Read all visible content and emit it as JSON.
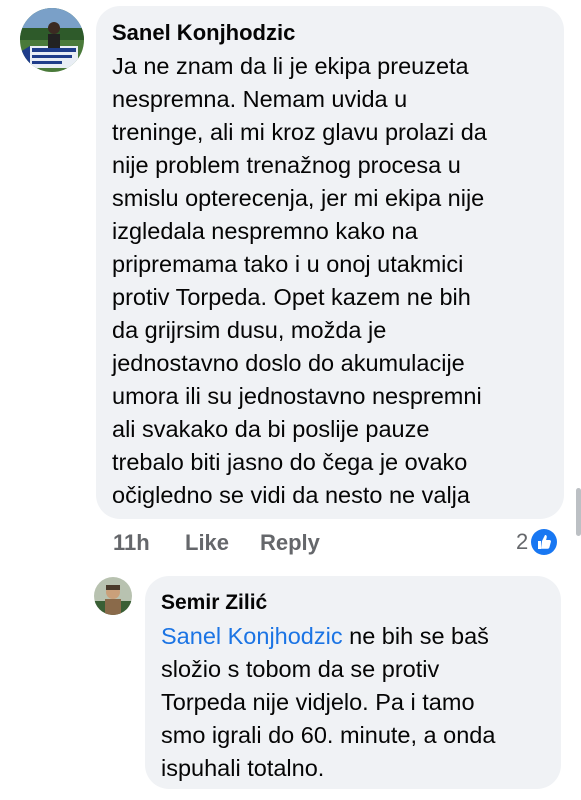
{
  "comment": {
    "author": "Sanel Konjhodzic",
    "lines": [
      "Ja ne znam da li je ekipa preuzeta",
      "nespremna. Nemam uvida u",
      "treninge, ali mi kroz glavu prolazi da",
      "nije problem trenažnog procesa u",
      "smislu opterecenja, jer mi ekipa nije",
      "izgledala nespremno kako na",
      "pripremama tako i u onoj utakmici",
      "protiv Torpeda. Opet kazem ne bih",
      "da grijrsim dusu, možda je",
      "jednostavno doslo do akumulacije",
      "umora ili su jednostavno nespremni",
      "ali svakako da bi poslije pauze",
      "trebalo biti jasno do čega je ovako",
      "očigledno se vidi da nesto ne valja"
    ],
    "time": "11h",
    "like_label": "Like",
    "reply_label": "Reply",
    "reaction_count": "2",
    "reaction_icon": "like-thumb-icon",
    "colors": {
      "reaction_blue": "#1877f2"
    }
  },
  "reply": {
    "author": "Semir Zilić",
    "mention": "Sanel Konjhodzic",
    "first_line_rest": " ne bih se baš",
    "lines": [
      "složio s tobom da se protiv",
      "Torpeda nije vidjelo. Pa i tamo",
      "smo igrali do 60. minute, a onda",
      "ispuhali totalno."
    ]
  },
  "colors": {
    "bubble": "#f0f2f5",
    "link": "#1b74e4",
    "meta": "#65676b"
  }
}
